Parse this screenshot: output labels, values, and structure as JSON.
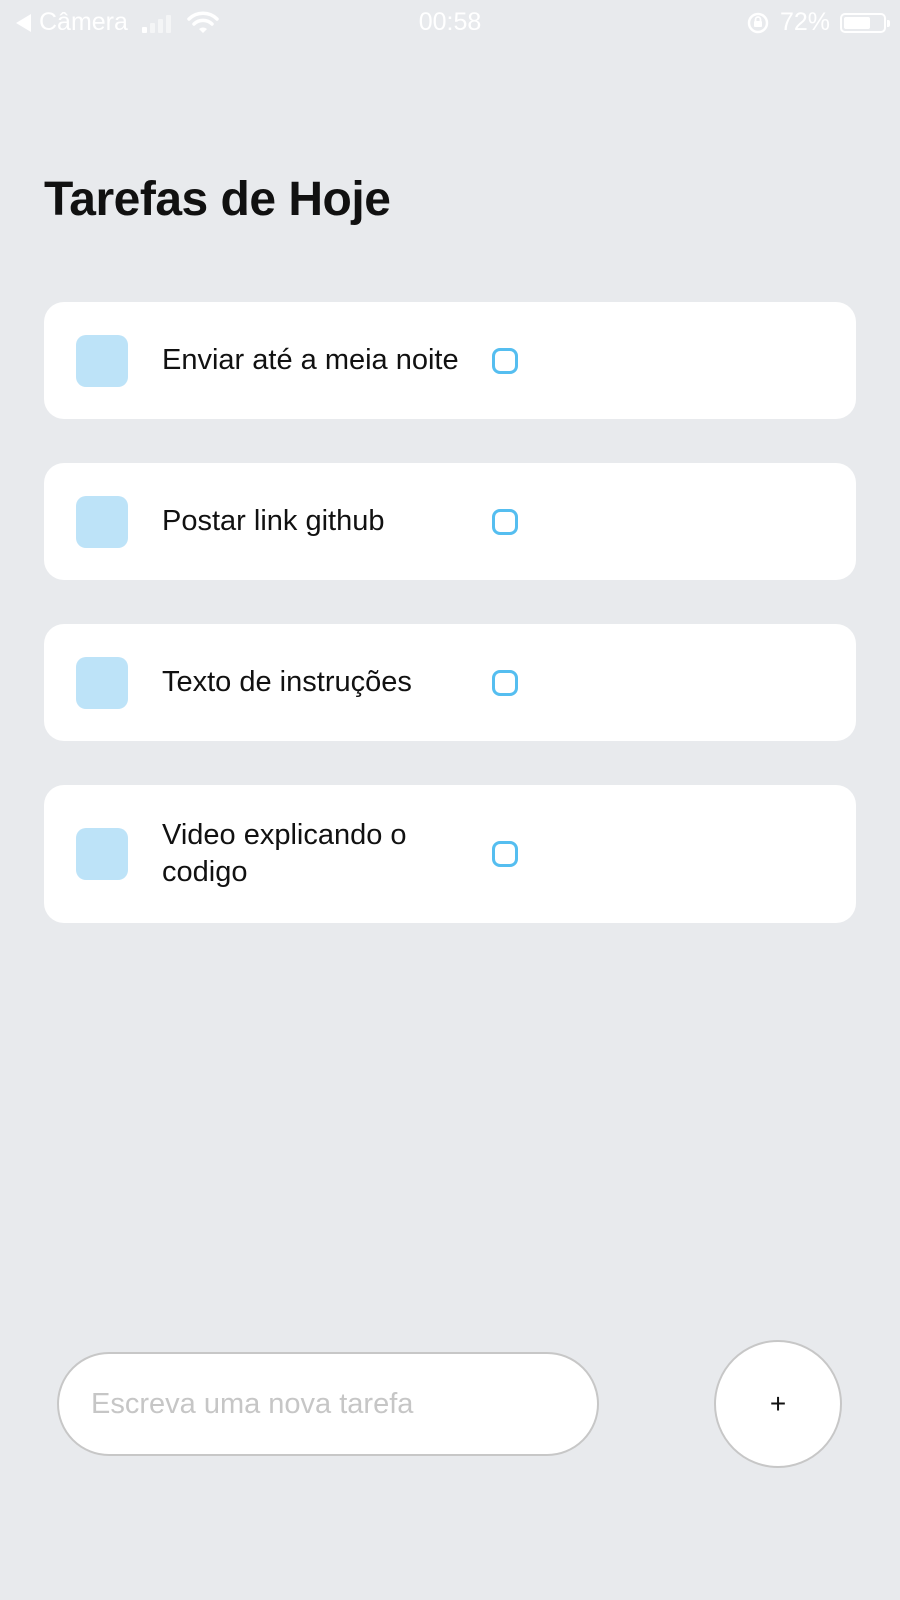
{
  "status_bar": {
    "back_label": "Câmera",
    "time": "00:58",
    "battery": "72%",
    "battery_level": 0.72,
    "signal_bars_active": 1,
    "signal_bars_total": 4
  },
  "header": {
    "title": "Tarefas de Hoje"
  },
  "tasks": [
    {
      "text": "Enviar até a meia noite"
    },
    {
      "text": "Postar link github"
    },
    {
      "text": "Texto de instruções"
    },
    {
      "text": "Video explicando o codigo"
    }
  ],
  "composer": {
    "placeholder": "Escreva uma nova tarefa",
    "value": "",
    "add_label": "+"
  },
  "colors": {
    "background": "#E8EAED",
    "card": "#FFFFFF",
    "task_square": "#BDE3F8",
    "accent": "#55BEF0"
  },
  "icons": {
    "back": "back-arrow-icon",
    "signal": "cellular-signal-icon",
    "wifi": "wifi-icon",
    "rotation_lock": "rotation-lock-icon",
    "battery": "battery-icon",
    "task_marker": "task-square-icon",
    "task_status": "task-circle-icon"
  }
}
